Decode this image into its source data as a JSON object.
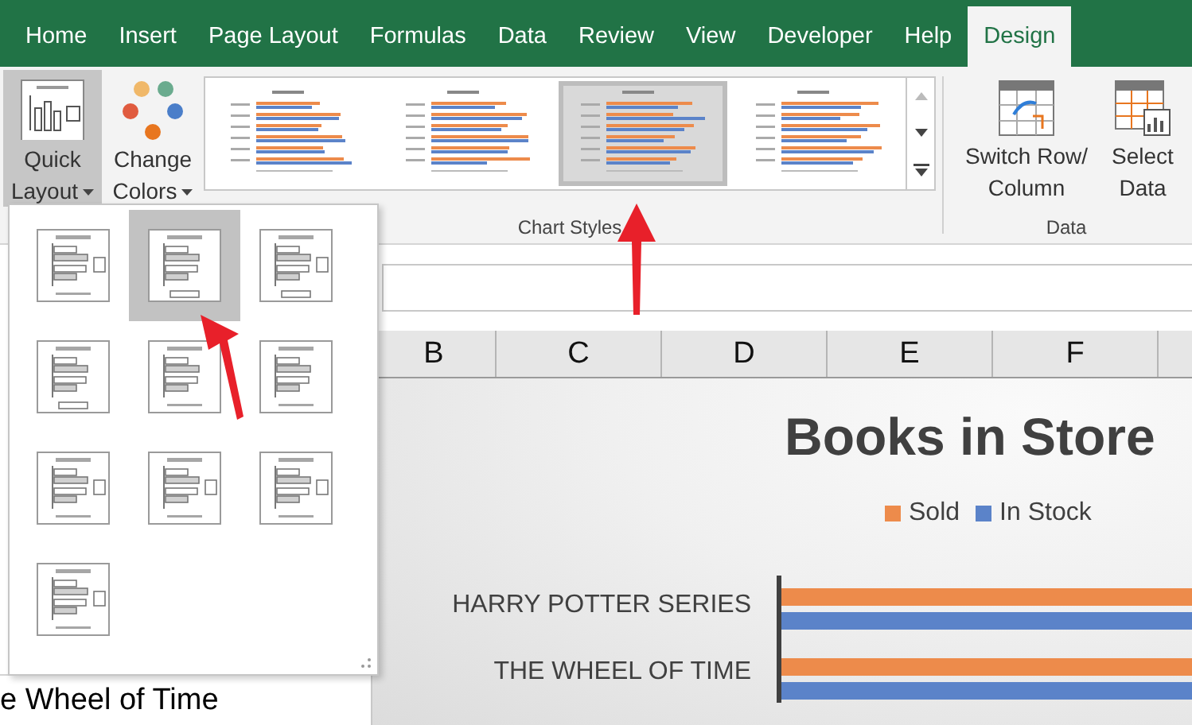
{
  "tabs": [
    {
      "label": "Home",
      "selected": false
    },
    {
      "label": "Insert",
      "selected": false
    },
    {
      "label": "Page Layout",
      "selected": false
    },
    {
      "label": "Formulas",
      "selected": false
    },
    {
      "label": "Data",
      "selected": false
    },
    {
      "label": "Review",
      "selected": false
    },
    {
      "label": "View",
      "selected": false
    },
    {
      "label": "Developer",
      "selected": false
    },
    {
      "label": "Help",
      "selected": false
    },
    {
      "label": "Design",
      "selected": true
    }
  ],
  "ribbon": {
    "quick_layout": {
      "label": "Quick Layout",
      "expanded": true
    },
    "change_colors": {
      "label": "Change Colors"
    },
    "chart_styles": {
      "label": "Chart Styles",
      "styles": [
        {
          "selected": false
        },
        {
          "selected": false
        },
        {
          "selected": true
        },
        {
          "selected": false
        }
      ]
    },
    "data_group": {
      "label": "Data",
      "buttons": [
        {
          "label": "Switch Row/ Column",
          "kind": "switch"
        },
        {
          "label": "Select Data",
          "kind": "select"
        }
      ]
    }
  },
  "layout_menu": {
    "layouts": [
      {
        "selected": false
      },
      {
        "selected": true
      },
      {
        "selected": false
      },
      {
        "selected": false
      },
      {
        "selected": false
      },
      {
        "selected": false
      },
      {
        "selected": false
      },
      {
        "selected": false
      },
      {
        "selected": false
      },
      {
        "selected": false
      }
    ]
  },
  "sheet": {
    "columns": [
      "B",
      "C",
      "D",
      "E",
      "F"
    ],
    "cells": [
      "e Wheel of Time"
    ]
  },
  "chart": {
    "title": "Books in Store",
    "legend": [
      {
        "name": "Sold",
        "color": "#ed8b4b"
      },
      {
        "name": "In Stock",
        "color": "#5b83c9"
      }
    ],
    "categories": [
      "HARRY POTTER SERIES",
      "THE WHEEL OF TIME"
    ]
  }
}
